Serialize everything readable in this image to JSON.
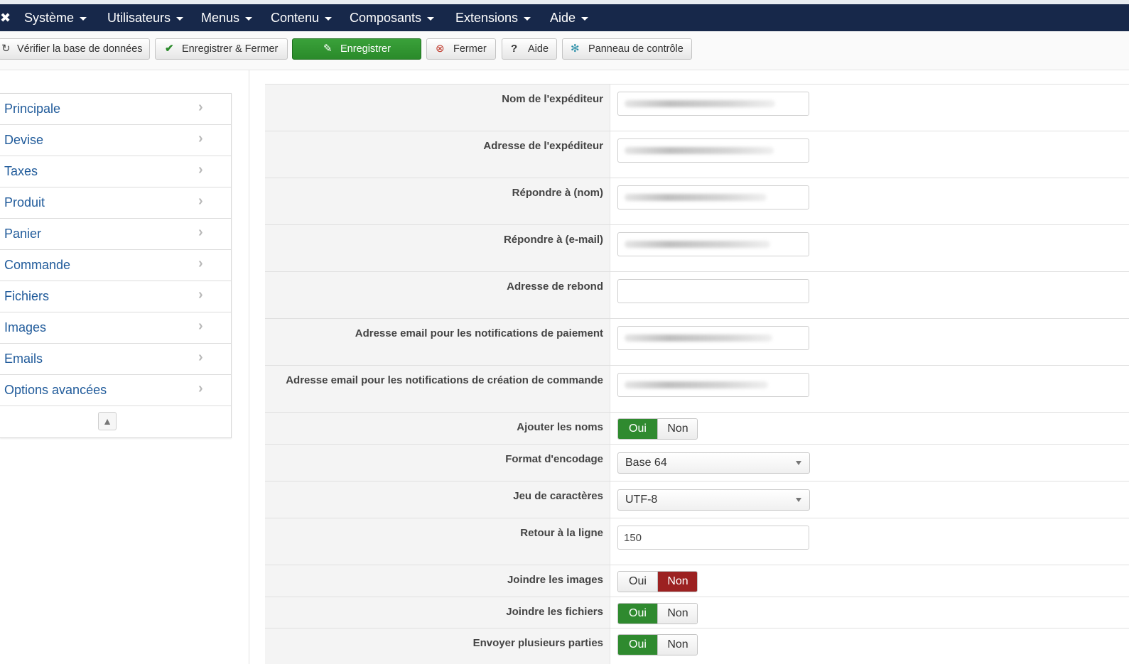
{
  "nav": {
    "items": [
      "Système",
      "Utilisateurs",
      "Menus",
      "Contenu",
      "Composants",
      "Extensions",
      "Aide"
    ]
  },
  "toolbar": {
    "check_db": "Vérifier la base de données",
    "save_close": "Enregistrer & Fermer",
    "save": "Enregistrer",
    "close": "Fermer",
    "help": "Aide",
    "control_panel": "Panneau de contrôle"
  },
  "sidebar": {
    "items": [
      "Principale",
      "Devise",
      "Taxes",
      "Produit",
      "Panier",
      "Commande",
      "Fichiers",
      "Images",
      "Emails",
      "Options avancées"
    ]
  },
  "form": {
    "sender_name": {
      "label": "Nom de l'expéditeur"
    },
    "sender_address": {
      "label": "Adresse de l'expéditeur"
    },
    "reply_to_name": {
      "label": "Répondre à (nom)"
    },
    "reply_to_email": {
      "label": "Répondre à (e-mail)"
    },
    "bounce_address": {
      "label": "Adresse de rebond",
      "value": ""
    },
    "payment_notification_email": {
      "label": "Adresse email pour les notifications de paiement"
    },
    "order_creation_notification_email": {
      "label": "Adresse email pour les notifications de création de commande"
    },
    "add_names": {
      "label": "Ajouter les noms",
      "yes": "Oui",
      "no": "Non",
      "selected": "Oui"
    },
    "encoding_format": {
      "label": "Format d'encodage",
      "value": "Base 64"
    },
    "charset": {
      "label": "Jeu de caractères",
      "value": "UTF-8"
    },
    "word_wrap": {
      "label": "Retour à la ligne",
      "value": "150"
    },
    "attach_images": {
      "label": "Joindre les images",
      "yes": "Oui",
      "no": "Non",
      "selected": "Non"
    },
    "attach_files": {
      "label": "Joindre les fichiers",
      "yes": "Oui",
      "no": "Non",
      "selected": "Oui"
    },
    "send_multipart": {
      "label": "Envoyer plusieurs parties",
      "yes": "Oui",
      "no": "Non",
      "selected": "Oui"
    }
  },
  "colors": {
    "navbar": "#17284a",
    "link": "#1f5a9a",
    "success": "#2f8a2f",
    "danger": "#9c2121"
  }
}
